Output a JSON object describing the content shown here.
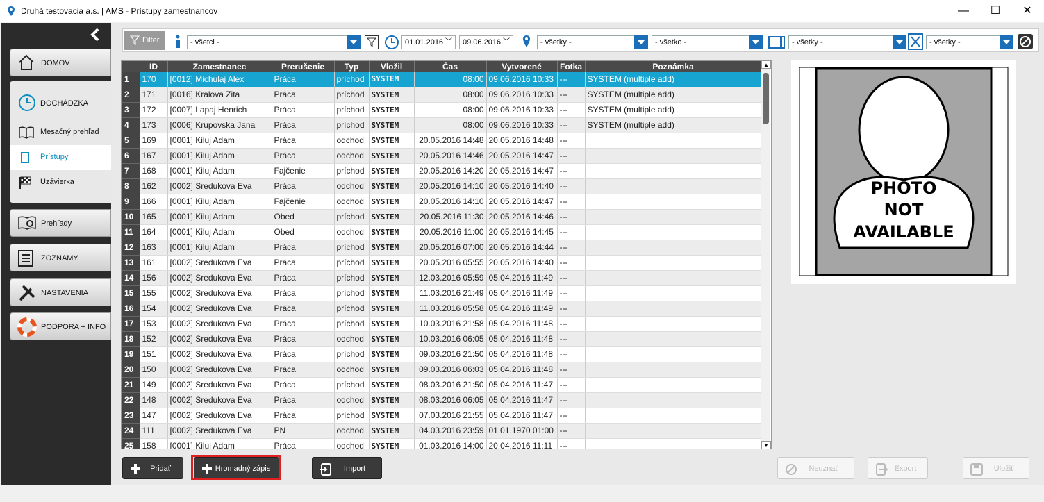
{
  "window": {
    "title": "Druhá testovacia a.s. | AMS - Prístupy zamestnancov",
    "minimize": "—",
    "maximize": "☐",
    "close": "✕"
  },
  "sidebar": {
    "items": [
      {
        "label": "DOMOV",
        "icon": "home-icon"
      },
      {
        "label": "DOCHÁDZKA",
        "icon": "clock-icon"
      },
      {
        "label": "Mesačný prehľad",
        "icon": "book-icon"
      },
      {
        "label": "Prístupy",
        "icon": "door-icon"
      },
      {
        "label": "Uzávierka",
        "icon": "flag-icon"
      },
      {
        "label": "Prehľady",
        "icon": "report-icon"
      },
      {
        "label": "ZOZNAMY",
        "icon": "list-icon"
      },
      {
        "label": "NASTAVENIA",
        "icon": "tools-icon"
      },
      {
        "label": "PODPORA + INFO",
        "icon": "lifebuoy-icon"
      }
    ]
  },
  "filter": {
    "button_label": "Filter",
    "employee": "- všetci -",
    "date_from": "01.01.2016",
    "date_to": "09.06.2016",
    "location": "- všetky -",
    "all": "- všetko -",
    "terminal": "- všetky -",
    "type": "- všetky -"
  },
  "table": {
    "columns": [
      "",
      "ID",
      "Zamestnanec",
      "Prerušenie",
      "Typ",
      "Vložil",
      "Čas",
      "Vytvorené",
      "Fotka",
      "Poznámka"
    ],
    "rows": [
      [
        "1",
        "170",
        "[0012] Michulaj Alex",
        "Práca",
        "príchod",
        "SYSTEM",
        "08:00",
        "09.06.2016 10:33",
        "---",
        "SYSTEM (multiple add)"
      ],
      [
        "2",
        "171",
        "[0016] Kralova Zita",
        "Práca",
        "príchod",
        "SYSTEM",
        "08:00",
        "09.06.2016 10:33",
        "---",
        "SYSTEM (multiple add)"
      ],
      [
        "3",
        "172",
        "[0007] Lapaj Henrich",
        "Práca",
        "príchod",
        "SYSTEM",
        "08:00",
        "09.06.2016 10:33",
        "---",
        "SYSTEM (multiple add)"
      ],
      [
        "4",
        "173",
        "[0006] Krupovska Jana",
        "Práca",
        "príchod",
        "SYSTEM",
        "08:00",
        "09.06.2016 10:33",
        "---",
        "SYSTEM (multiple add)"
      ],
      [
        "5",
        "169",
        "[0001] Kiluj Adam",
        "Práca",
        "odchod",
        "SYSTEM",
        "20.05.2016 14:48",
        "20.05.2016 14:48",
        "---",
        ""
      ],
      [
        "6",
        "167",
        "[0001] Kiluj Adam",
        "Práca",
        "odchod",
        "SYSTEM",
        "20.05.2016 14:46",
        "20.05.2016 14:47",
        "---",
        ""
      ],
      [
        "7",
        "168",
        "[0001] Kiluj Adam",
        "Fajčenie",
        "príchod",
        "SYSTEM",
        "20.05.2016 14:20",
        "20.05.2016 14:47",
        "---",
        ""
      ],
      [
        "8",
        "162",
        "[0002] Sredukova Eva",
        "Práca",
        "odchod",
        "SYSTEM",
        "20.05.2016 14:10",
        "20.05.2016 14:40",
        "---",
        ""
      ],
      [
        "9",
        "166",
        "[0001] Kiluj Adam",
        "Fajčenie",
        "odchod",
        "SYSTEM",
        "20.05.2016 14:10",
        "20.05.2016 14:47",
        "---",
        ""
      ],
      [
        "10",
        "165",
        "[0001] Kiluj Adam",
        "Obed",
        "príchod",
        "SYSTEM",
        "20.05.2016 11:30",
        "20.05.2016 14:46",
        "---",
        ""
      ],
      [
        "11",
        "164",
        "[0001] Kiluj Adam",
        "Obed",
        "odchod",
        "SYSTEM",
        "20.05.2016 11:00",
        "20.05.2016 14:45",
        "---",
        ""
      ],
      [
        "12",
        "163",
        "[0001] Kiluj Adam",
        "Práca",
        "príchod",
        "SYSTEM",
        "20.05.2016 07:00",
        "20.05.2016 14:44",
        "---",
        ""
      ],
      [
        "13",
        "161",
        "[0002] Sredukova Eva",
        "Práca",
        "príchod",
        "SYSTEM",
        "20.05.2016 05:55",
        "20.05.2016 14:40",
        "---",
        ""
      ],
      [
        "14",
        "156",
        "[0002] Sredukova Eva",
        "Práca",
        "príchod",
        "SYSTEM",
        "12.03.2016 05:59",
        "05.04.2016 11:49",
        "---",
        ""
      ],
      [
        "15",
        "155",
        "[0002] Sredukova Eva",
        "Práca",
        "príchod",
        "SYSTEM",
        "11.03.2016 21:49",
        "05.04.2016 11:49",
        "---",
        ""
      ],
      [
        "16",
        "154",
        "[0002] Sredukova Eva",
        "Práca",
        "príchod",
        "SYSTEM",
        "11.03.2016 05:58",
        "05.04.2016 11:49",
        "---",
        ""
      ],
      [
        "17",
        "153",
        "[0002] Sredukova Eva",
        "Práca",
        "príchod",
        "SYSTEM",
        "10.03.2016 21:58",
        "05.04.2016 11:48",
        "---",
        ""
      ],
      [
        "18",
        "152",
        "[0002] Sredukova Eva",
        "Práca",
        "odchod",
        "SYSTEM",
        "10.03.2016 06:05",
        "05.04.2016 11:48",
        "---",
        ""
      ],
      [
        "19",
        "151",
        "[0002] Sredukova Eva",
        "Práca",
        "príchod",
        "SYSTEM",
        "09.03.2016 21:50",
        "05.04.2016 11:48",
        "---",
        ""
      ],
      [
        "20",
        "150",
        "[0002] Sredukova Eva",
        "Práca",
        "odchod",
        "SYSTEM",
        "09.03.2016 06:03",
        "05.04.2016 11:48",
        "---",
        ""
      ],
      [
        "21",
        "149",
        "[0002] Sredukova Eva",
        "Práca",
        "príchod",
        "SYSTEM",
        "08.03.2016 21:50",
        "05.04.2016 11:47",
        "---",
        ""
      ],
      [
        "22",
        "148",
        "[0002] Sredukova Eva",
        "Práca",
        "odchod",
        "SYSTEM",
        "08.03.2016 06:05",
        "05.04.2016 11:47",
        "---",
        ""
      ],
      [
        "23",
        "147",
        "[0002] Sredukova Eva",
        "Práca",
        "príchod",
        "SYSTEM",
        "07.03.2016 21:55",
        "05.04.2016 11:47",
        "---",
        ""
      ],
      [
        "24",
        "111",
        "[0002] Sredukova Eva",
        "PN",
        "odchod",
        "SYSTEM",
        "04.03.2016 23:59",
        "01.01.1970 01:00",
        "---",
        ""
      ],
      [
        "25",
        "158",
        "[0001] Kiluj Adam",
        "Práca",
        "odchod",
        "SYSTEM",
        "01.03.2016 14:00",
        "20.04.2016 11:11",
        "---",
        ""
      ]
    ]
  },
  "photo": {
    "line1": "PHOTO",
    "line2": "NOT",
    "line3": "AVAILABLE"
  },
  "buttons": {
    "add": "Pridať",
    "bulk": "Hromadný zápis",
    "import": "Import",
    "reject": "Neuznať",
    "export": "Export",
    "save": "Uložiť"
  },
  "colors": {
    "accent": "#17a4d0",
    "dropdown": "#1b6fb8",
    "highlight": "#e02020"
  }
}
